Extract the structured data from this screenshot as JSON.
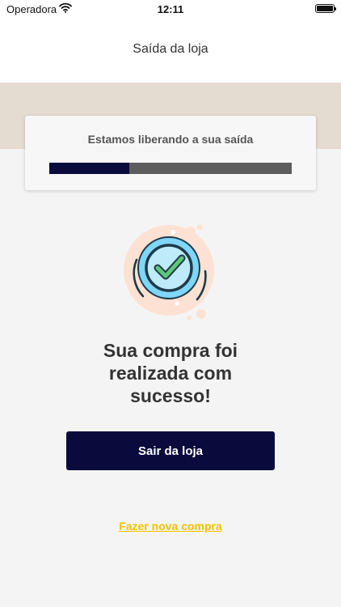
{
  "status_bar": {
    "carrier": "Operadora",
    "time": "12:11"
  },
  "nav": {
    "title": "Saída da loja"
  },
  "progress_card": {
    "label": "Estamos liberando a sua saída",
    "progress_fraction": 0.33,
    "fill_color": "#0a0a3c",
    "track_color": "#5d5d5d"
  },
  "illustration": {
    "icon": "check-circle-icon",
    "check_color": "#5ec77a",
    "ring_color": "#7fd6f7",
    "halo_color": "#fde2d3"
  },
  "main": {
    "headline_lines": [
      "Sua compra foi",
      "realizada com",
      "sucesso!"
    ]
  },
  "actions": {
    "primary_label": "Sair da loja",
    "secondary_label": "Fazer nova compra"
  },
  "colors": {
    "primary": "#0a0a3c",
    "link": "#f2c200",
    "beige": "#e4dbd1"
  }
}
